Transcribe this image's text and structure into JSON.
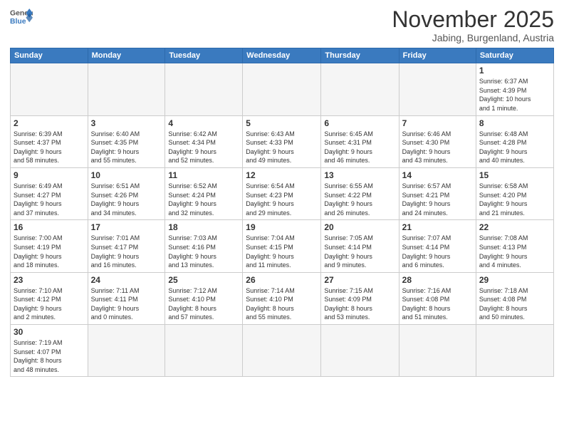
{
  "header": {
    "logo_general": "General",
    "logo_blue": "Blue",
    "month_title": "November 2025",
    "location": "Jabing, Burgenland, Austria"
  },
  "days_of_week": [
    "Sunday",
    "Monday",
    "Tuesday",
    "Wednesday",
    "Thursday",
    "Friday",
    "Saturday"
  ],
  "weeks": [
    [
      {
        "day": "",
        "info": ""
      },
      {
        "day": "",
        "info": ""
      },
      {
        "day": "",
        "info": ""
      },
      {
        "day": "",
        "info": ""
      },
      {
        "day": "",
        "info": ""
      },
      {
        "day": "",
        "info": ""
      },
      {
        "day": "1",
        "info": "Sunrise: 6:37 AM\nSunset: 4:39 PM\nDaylight: 10 hours\nand 1 minute."
      }
    ],
    [
      {
        "day": "2",
        "info": "Sunrise: 6:39 AM\nSunset: 4:37 PM\nDaylight: 9 hours\nand 58 minutes."
      },
      {
        "day": "3",
        "info": "Sunrise: 6:40 AM\nSunset: 4:35 PM\nDaylight: 9 hours\nand 55 minutes."
      },
      {
        "day": "4",
        "info": "Sunrise: 6:42 AM\nSunset: 4:34 PM\nDaylight: 9 hours\nand 52 minutes."
      },
      {
        "day": "5",
        "info": "Sunrise: 6:43 AM\nSunset: 4:33 PM\nDaylight: 9 hours\nand 49 minutes."
      },
      {
        "day": "6",
        "info": "Sunrise: 6:45 AM\nSunset: 4:31 PM\nDaylight: 9 hours\nand 46 minutes."
      },
      {
        "day": "7",
        "info": "Sunrise: 6:46 AM\nSunset: 4:30 PM\nDaylight: 9 hours\nand 43 minutes."
      },
      {
        "day": "8",
        "info": "Sunrise: 6:48 AM\nSunset: 4:28 PM\nDaylight: 9 hours\nand 40 minutes."
      }
    ],
    [
      {
        "day": "9",
        "info": "Sunrise: 6:49 AM\nSunset: 4:27 PM\nDaylight: 9 hours\nand 37 minutes."
      },
      {
        "day": "10",
        "info": "Sunrise: 6:51 AM\nSunset: 4:26 PM\nDaylight: 9 hours\nand 34 minutes."
      },
      {
        "day": "11",
        "info": "Sunrise: 6:52 AM\nSunset: 4:24 PM\nDaylight: 9 hours\nand 32 minutes."
      },
      {
        "day": "12",
        "info": "Sunrise: 6:54 AM\nSunset: 4:23 PM\nDaylight: 9 hours\nand 29 minutes."
      },
      {
        "day": "13",
        "info": "Sunrise: 6:55 AM\nSunset: 4:22 PM\nDaylight: 9 hours\nand 26 minutes."
      },
      {
        "day": "14",
        "info": "Sunrise: 6:57 AM\nSunset: 4:21 PM\nDaylight: 9 hours\nand 24 minutes."
      },
      {
        "day": "15",
        "info": "Sunrise: 6:58 AM\nSunset: 4:20 PM\nDaylight: 9 hours\nand 21 minutes."
      }
    ],
    [
      {
        "day": "16",
        "info": "Sunrise: 7:00 AM\nSunset: 4:19 PM\nDaylight: 9 hours\nand 18 minutes."
      },
      {
        "day": "17",
        "info": "Sunrise: 7:01 AM\nSunset: 4:17 PM\nDaylight: 9 hours\nand 16 minutes."
      },
      {
        "day": "18",
        "info": "Sunrise: 7:03 AM\nSunset: 4:16 PM\nDaylight: 9 hours\nand 13 minutes."
      },
      {
        "day": "19",
        "info": "Sunrise: 7:04 AM\nSunset: 4:15 PM\nDaylight: 9 hours\nand 11 minutes."
      },
      {
        "day": "20",
        "info": "Sunrise: 7:05 AM\nSunset: 4:14 PM\nDaylight: 9 hours\nand 9 minutes."
      },
      {
        "day": "21",
        "info": "Sunrise: 7:07 AM\nSunset: 4:14 PM\nDaylight: 9 hours\nand 6 minutes."
      },
      {
        "day": "22",
        "info": "Sunrise: 7:08 AM\nSunset: 4:13 PM\nDaylight: 9 hours\nand 4 minutes."
      }
    ],
    [
      {
        "day": "23",
        "info": "Sunrise: 7:10 AM\nSunset: 4:12 PM\nDaylight: 9 hours\nand 2 minutes."
      },
      {
        "day": "24",
        "info": "Sunrise: 7:11 AM\nSunset: 4:11 PM\nDaylight: 9 hours\nand 0 minutes."
      },
      {
        "day": "25",
        "info": "Sunrise: 7:12 AM\nSunset: 4:10 PM\nDaylight: 8 hours\nand 57 minutes."
      },
      {
        "day": "26",
        "info": "Sunrise: 7:14 AM\nSunset: 4:10 PM\nDaylight: 8 hours\nand 55 minutes."
      },
      {
        "day": "27",
        "info": "Sunrise: 7:15 AM\nSunset: 4:09 PM\nDaylight: 8 hours\nand 53 minutes."
      },
      {
        "day": "28",
        "info": "Sunrise: 7:16 AM\nSunset: 4:08 PM\nDaylight: 8 hours\nand 51 minutes."
      },
      {
        "day": "29",
        "info": "Sunrise: 7:18 AM\nSunset: 4:08 PM\nDaylight: 8 hours\nand 50 minutes."
      }
    ],
    [
      {
        "day": "30",
        "info": "Sunrise: 7:19 AM\nSunset: 4:07 PM\nDaylight: 8 hours\nand 48 minutes."
      },
      {
        "day": "",
        "info": ""
      },
      {
        "day": "",
        "info": ""
      },
      {
        "day": "",
        "info": ""
      },
      {
        "day": "",
        "info": ""
      },
      {
        "day": "",
        "info": ""
      },
      {
        "day": "",
        "info": ""
      }
    ]
  ]
}
